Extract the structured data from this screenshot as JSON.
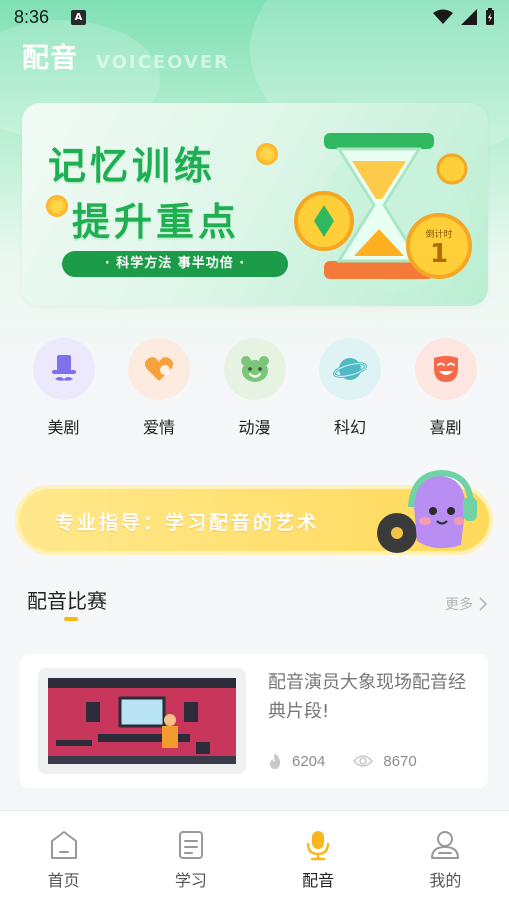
{
  "status_bar": {
    "time": "8:36",
    "notif_badge": "A"
  },
  "header": {
    "title": "配音",
    "subtitle": "VOICEOVER"
  },
  "banner": {
    "line1": "记忆训练",
    "line2": "提升重点",
    "pill": "· 科学方法 事半功倍 ·",
    "badge_label": "倒计时",
    "badge_number": "1"
  },
  "categories": [
    {
      "label": "美剧",
      "icon": "top-hat-icon",
      "color": "#ebe9fb",
      "icon_color": "#7f72e8"
    },
    {
      "label": "爱情",
      "icon": "heart-icon",
      "color": "#fdebe0",
      "icon_color": "#f5a23c"
    },
    {
      "label": "动漫",
      "icon": "bear-icon",
      "color": "#e6f3e2",
      "icon_color": "#7cc57a"
    },
    {
      "label": "科幻",
      "icon": "planet-icon",
      "color": "#e0f3f4",
      "icon_color": "#4fb9c6"
    },
    {
      "label": "喜剧",
      "icon": "mask-icon",
      "color": "#fde6df",
      "icon_color": "#f46a4a"
    }
  ],
  "promo": {
    "text": "专业指导：学习配音的艺术"
  },
  "section": {
    "title": "配音比赛",
    "more": "更多"
  },
  "card": {
    "title": "配音演员大象现场配音经典片段!",
    "likes": "6204",
    "views": "8670"
  },
  "tabs": [
    {
      "label": "首页",
      "icon": "home-icon",
      "active": false
    },
    {
      "label": "学习",
      "icon": "document-icon",
      "active": false
    },
    {
      "label": "配音",
      "icon": "microphone-icon",
      "active": true
    },
    {
      "label": "我的",
      "icon": "user-icon",
      "active": false
    }
  ],
  "colors": {
    "accent_green": "#1fae52",
    "accent_yellow": "#f8b71c",
    "tab_active": "#f8b71c"
  }
}
